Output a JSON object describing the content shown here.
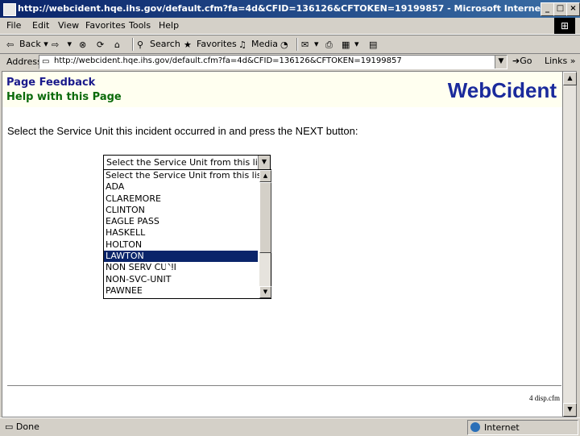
{
  "window": {
    "title": "http://webcident.hqe.ihs.gov/default.cfm?fa=4d&CFID=136126&CFTOKEN=19199857 - Microsoft Internet Explorer"
  },
  "menu": [
    "File",
    "Edit",
    "View",
    "Favorites",
    "Tools",
    "Help"
  ],
  "toolbar": {
    "back": "Back",
    "search": "Search",
    "favorites": "Favorites",
    "media": "Media"
  },
  "address": {
    "label": "Address",
    "url": "http://webcident.hqe.ihs.gov/default.cfm?fa=4d&CFID=136126&CFTOKEN=19199857",
    "go": "Go",
    "links": "Links"
  },
  "page": {
    "feedback_link": "Page Feedback",
    "help_link": "Help with this Page",
    "brand": "WebCident",
    "instruction": "Select the Service Unit this incident occurred in and press the NEXT button:",
    "select_value": "Select the Service Unit from this list",
    "options": [
      "Select the Service Unit from this list",
      "ADA",
      "CLAREMORE",
      "CLINTON",
      "EAGLE PASS",
      "HASKELL",
      "HOLTON",
      "LAWTON",
      "NON SERV CUNI",
      "NON-SVC-UNIT",
      "PAWNEE"
    ],
    "selected_option": "LAWTON",
    "footer": "4 disp.cfm"
  },
  "status": {
    "text": "Done",
    "zone": "Internet"
  }
}
